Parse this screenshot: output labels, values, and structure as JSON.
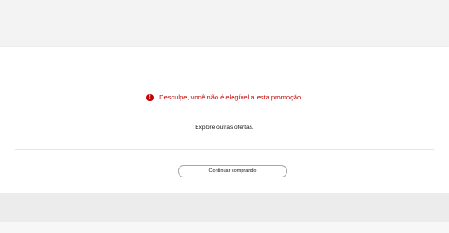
{
  "promotion_status": {
    "icon": "alert-icon",
    "icon_glyph": "!",
    "message": "Desculpe, você não é elegível a esta promoção.",
    "subtext": "Explore outras ofertas.",
    "continue_label": "Continuar comprando"
  },
  "colors": {
    "error": "#c40000",
    "background": "#f3f3f3",
    "card": "#ffffff",
    "button_border": "#a6a6a6"
  }
}
